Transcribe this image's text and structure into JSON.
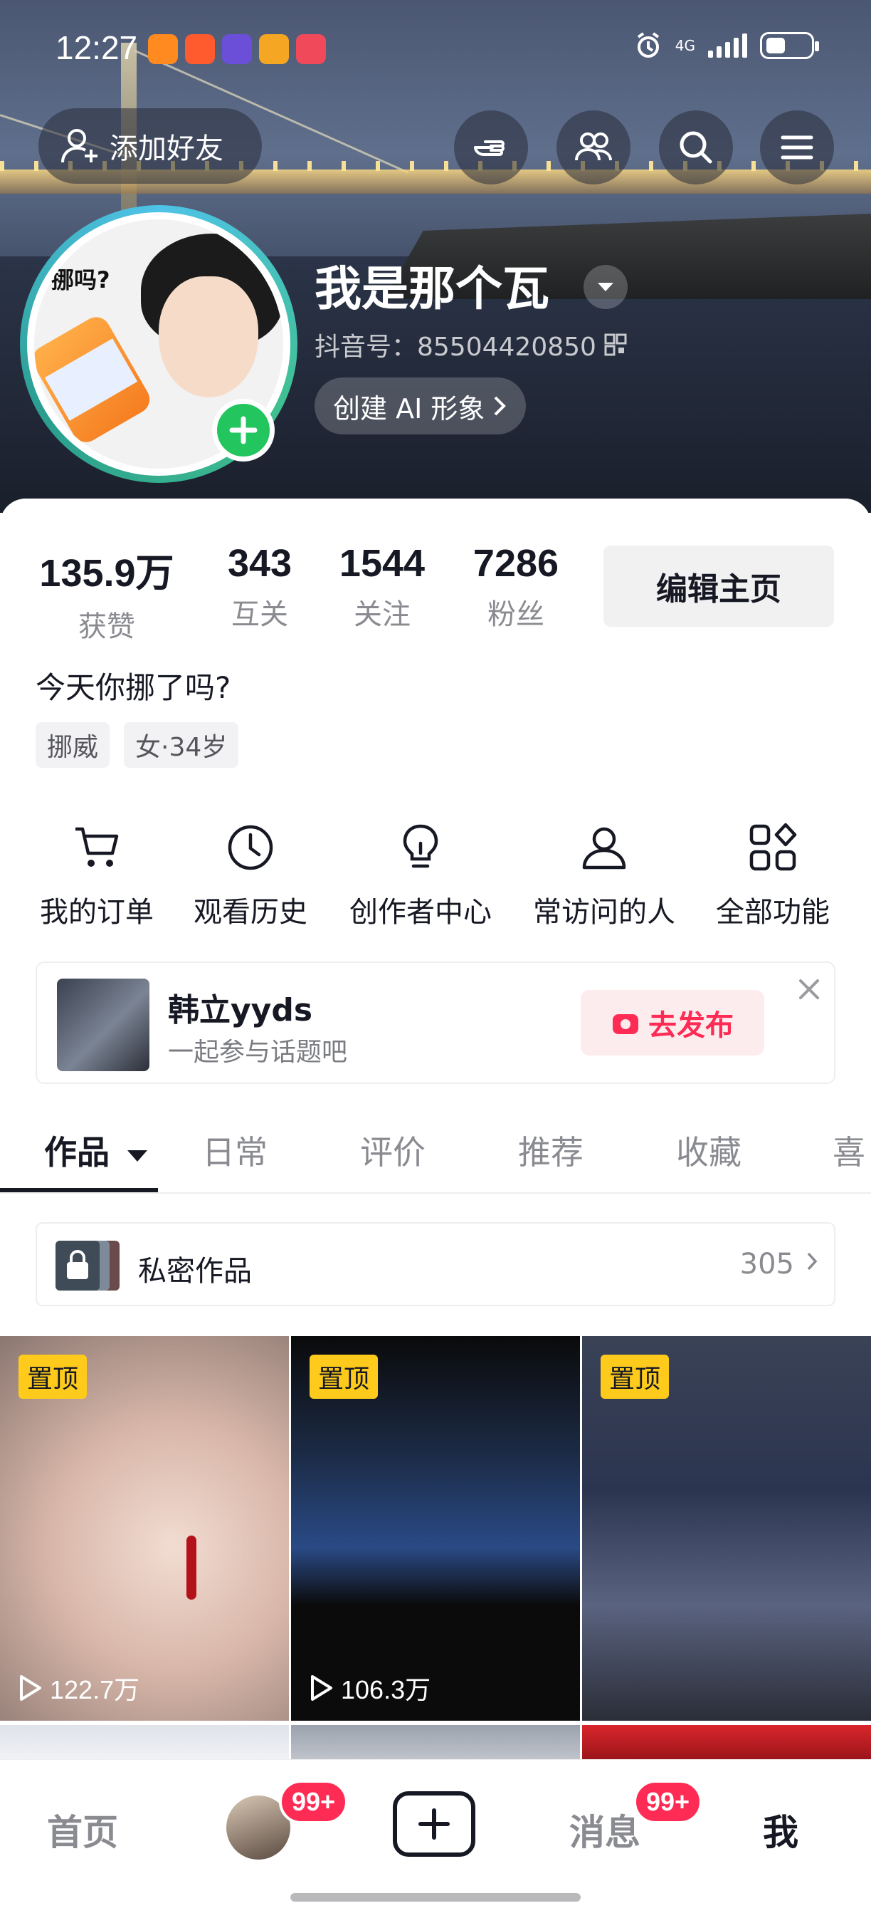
{
  "status_bar": {
    "time": "12:27",
    "network": "4G"
  },
  "header": {
    "add_friend_label": "添加好友",
    "icons": [
      "hand-point-icon",
      "friends-icon",
      "search-icon",
      "menu-icon"
    ]
  },
  "profile": {
    "avatar_caption": "挪吗?",
    "nickname": "我是那个瓦",
    "douyin_id": "抖音号：85504420850",
    "ai_chip_label": "创建 AI 形象"
  },
  "stats": [
    {
      "value": "135.9万",
      "label": "获赞"
    },
    {
      "value": "343",
      "label": "互关"
    },
    {
      "value": "1544",
      "label": "关注"
    },
    {
      "value": "7286",
      "label": "粉丝"
    }
  ],
  "edit_button_label": "编辑主页",
  "bio": "今天你挪了吗?",
  "tags": [
    "挪威",
    "女·34岁"
  ],
  "features": [
    {
      "label": "我的订单",
      "icon": "cart-icon"
    },
    {
      "label": "观看历史",
      "icon": "clock-icon"
    },
    {
      "label": "创作者中心",
      "icon": "lightbulb-icon"
    },
    {
      "label": "常访问的人",
      "icon": "person-icon"
    },
    {
      "label": "全部功能",
      "icon": "grid-icon"
    }
  ],
  "promo": {
    "title": "韩立yyds",
    "subtitle": "一起参与话题吧",
    "publish_label": "去发布"
  },
  "tabs": [
    "作品",
    "日常",
    "评价",
    "推荐",
    "收藏",
    "喜"
  ],
  "private_works": {
    "label": "私密作品",
    "count": "305"
  },
  "videos": [
    {
      "pinned_label": "置顶",
      "views": "122.7万"
    },
    {
      "pinned_label": "置顶",
      "views": "106.3万"
    },
    {
      "pinned_label": "置顶",
      "views": ""
    }
  ],
  "bottom_nav": {
    "home": "首页",
    "friends_badge": "99+",
    "messages": "消息",
    "messages_badge": "99+",
    "me": "我"
  },
  "colors": {
    "accent": "#fe2c55",
    "pin": "#fecb1d",
    "text": "#161823",
    "muted": "#8a8b91"
  }
}
